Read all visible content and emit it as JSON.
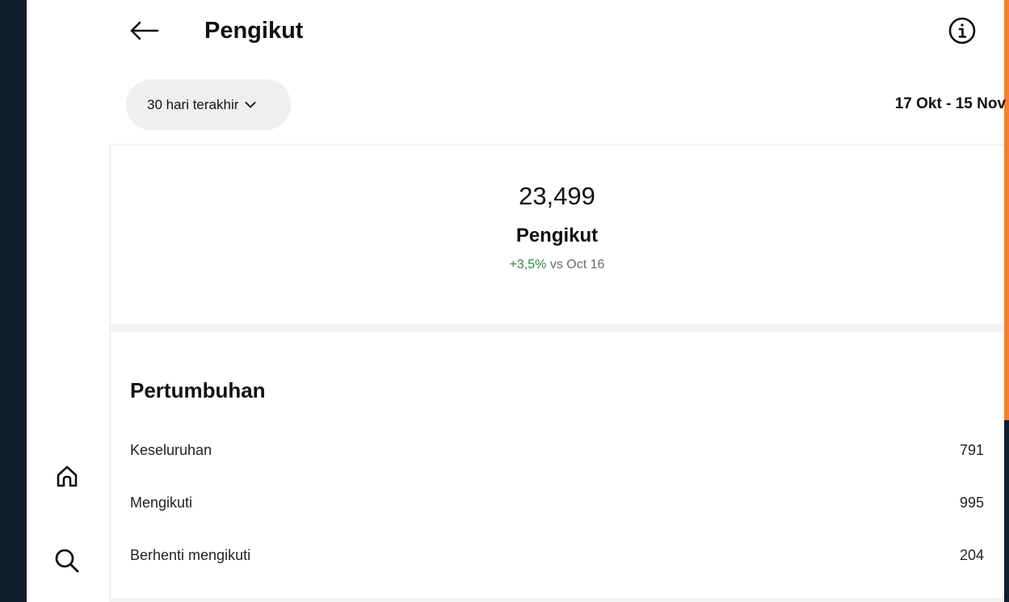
{
  "header": {
    "title": "Pengikut"
  },
  "filter": {
    "range_label": "30 hari terakhir",
    "date_range": "17 Okt - 15 Nov"
  },
  "summary": {
    "count": "23,499",
    "label": "Pengikut",
    "change_pct": "+3,5%",
    "change_text": "vs Oct 16"
  },
  "growth": {
    "title": "Pertumbuhan",
    "rows": [
      {
        "label": "Keseluruhan",
        "value": "791"
      },
      {
        "label": "Mengikuti",
        "value": "995"
      },
      {
        "label": "Berhenti mengikuti",
        "value": "204"
      }
    ]
  },
  "icons": {
    "back": "arrow-left-icon",
    "info": "info-icon",
    "chevron": "chevron-down-icon",
    "home": "home-icon",
    "search": "search-icon"
  },
  "colors": {
    "accent_orange": "#f47f34",
    "background_dark": "#0f1e2c",
    "positive_green": "#2e8b3a",
    "pill_bg": "#efeff1"
  }
}
